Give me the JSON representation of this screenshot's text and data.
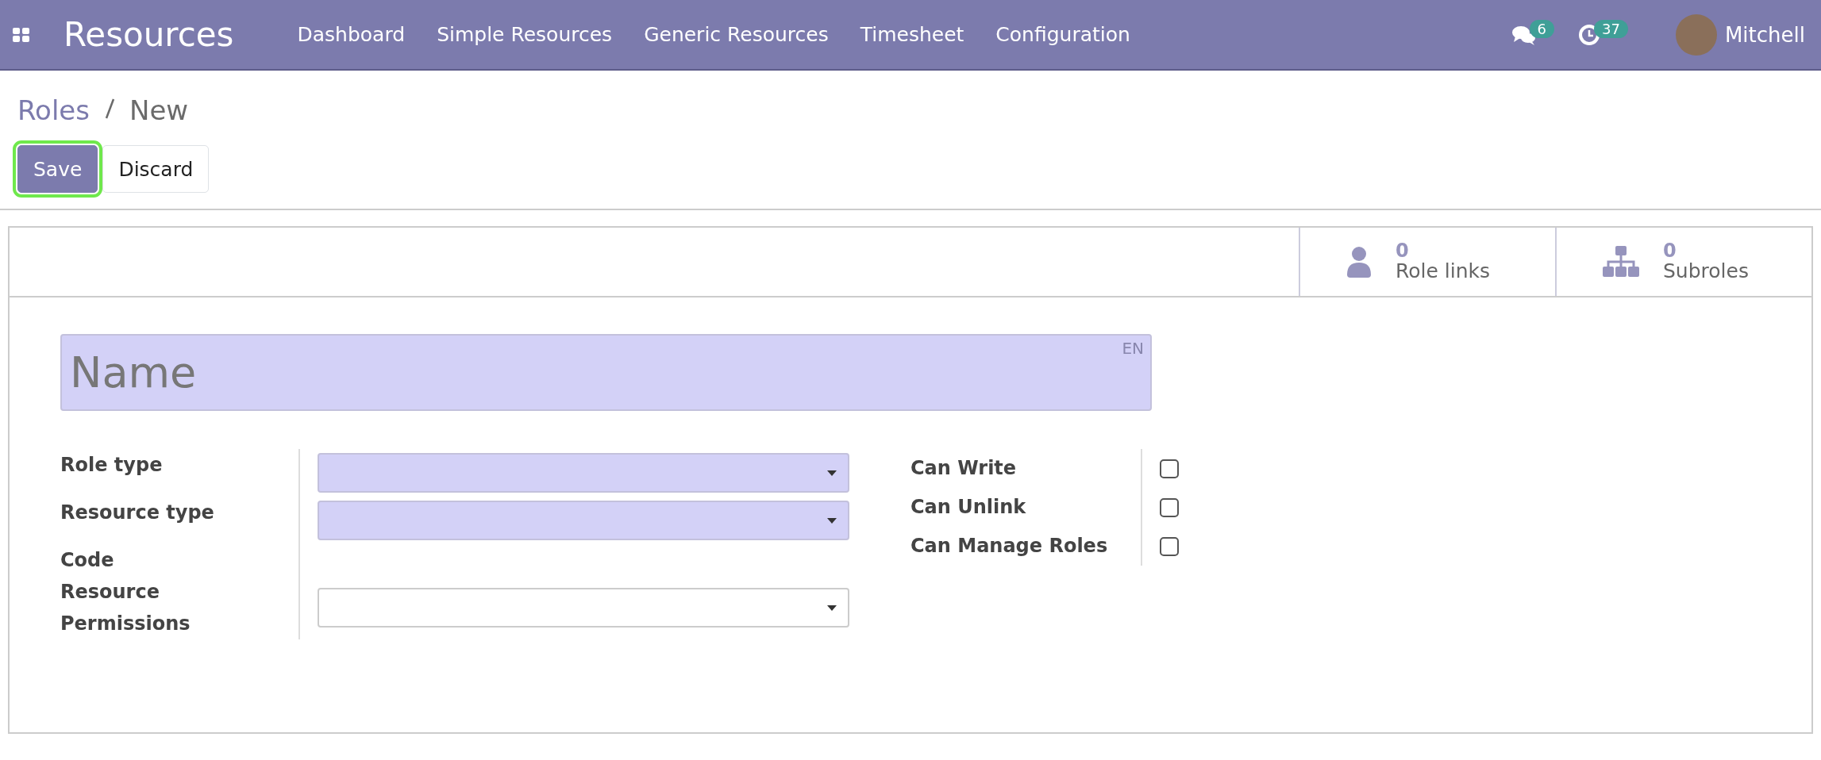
{
  "navbar": {
    "app_title": "Resources",
    "menu": [
      "Dashboard",
      "Simple Resources",
      "Generic Resources",
      "Timesheet",
      "Configuration"
    ],
    "messages_count": "6",
    "activities_count": "37",
    "user_name": "Mitchell"
  },
  "breadcrumb": {
    "parent": "Roles",
    "current": "New"
  },
  "buttons": [
    {
      "label": "Save",
      "kind": "primary",
      "focused": true
    },
    {
      "label": "Discard",
      "kind": "secondary",
      "focused": false
    }
  ],
  "stat_buttons": [
    {
      "kind": "person",
      "value": "0",
      "label": "Role links"
    },
    {
      "kind": "hierarchy",
      "value": "0",
      "label": "Subroles"
    }
  ],
  "name_field": {
    "placeholder": "Name",
    "language": "EN"
  },
  "left_fields": [
    {
      "label": "Role type",
      "kind": "select",
      "required": true
    },
    {
      "label": "Resource type",
      "kind": "select",
      "required": true
    },
    {
      "label": "Code",
      "kind": "empty"
    },
    {
      "label": "Resource Permissions",
      "kind": "select",
      "required": false
    }
  ],
  "right_fields": [
    {
      "label": "Can Write",
      "checked": false
    },
    {
      "label": "Can Unlink",
      "checked": false
    },
    {
      "label": "Can Manage Roles",
      "checked": false
    }
  ]
}
